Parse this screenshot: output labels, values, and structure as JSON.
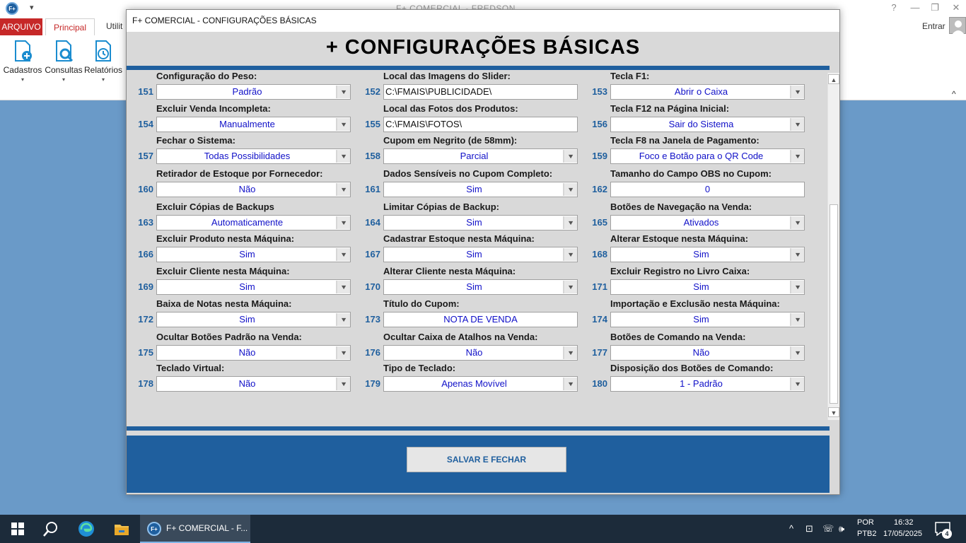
{
  "app": {
    "logo_text": "F+",
    "title": "F+ COMERCIAL - FREDSON",
    "qat_icon": "▾",
    "window_controls": [
      "?",
      "—",
      "❐",
      "✕"
    ],
    "tabs": {
      "arquivo": "ARQUIVO",
      "principal": "Principal",
      "utilitarios": "Utilit"
    },
    "entrar": "Entrar",
    "ribbon": [
      {
        "label": "Cadastros",
        "icon": "cadastros-icon"
      },
      {
        "label": "Consultas",
        "icon": "consultas-icon"
      },
      {
        "label": "Relatórios",
        "icon": "relatorios-icon"
      }
    ],
    "collapse_icon": "^"
  },
  "dialog": {
    "title": "F+ COMERCIAL - CONFIGURAÇÕES BÁSICAS",
    "heading": "+ CONFIGURAÇÕES BÁSICAS",
    "save_button": "SALVAR E FECHAR",
    "fields": [
      {
        "num": "151",
        "label": "Configuração do Peso:",
        "value": "Padrão",
        "kind": "select"
      },
      {
        "num": "152",
        "label": "Local das Imagens do Slider:",
        "value": "C:\\FMAIS\\PUBLICIDADE\\",
        "kind": "input-left"
      },
      {
        "num": "153",
        "label": "Tecla F1:",
        "value": "Abrir o Caixa",
        "kind": "select"
      },
      {
        "num": "154",
        "label": "Excluir Venda Incompleta:",
        "value": "Manualmente",
        "kind": "select"
      },
      {
        "num": "155",
        "label": "Local das Fotos dos Produtos:",
        "value": "C:\\FMAIS\\FOTOS\\",
        "kind": "input-left"
      },
      {
        "num": "156",
        "label": "Tecla F12 na Página Inicial:",
        "value": "Sair do Sistema",
        "kind": "select"
      },
      {
        "num": "157",
        "label": "Fechar o Sistema:",
        "value": "Todas Possibilidades",
        "kind": "select"
      },
      {
        "num": "158",
        "label": "Cupom em Negrito (de 58mm):",
        "value": "Parcial",
        "kind": "select"
      },
      {
        "num": "159",
        "label": "Tecla F8 na Janela de Pagamento:",
        "value": "Foco e Botão para o QR Code",
        "kind": "select"
      },
      {
        "num": "160",
        "label": "Retirador de Estoque por Fornecedor:",
        "value": "Não",
        "kind": "select"
      },
      {
        "num": "161",
        "label": "Dados Sensíveis no Cupom Completo:",
        "value": "Sim",
        "kind": "select"
      },
      {
        "num": "162",
        "label": "Tamanho do Campo OBS no Cupom:",
        "value": "0",
        "kind": "input-center"
      },
      {
        "num": "163",
        "label": "Excluir Cópias de Backups",
        "value": "Automaticamente",
        "kind": "select"
      },
      {
        "num": "164",
        "label": "Limitar Cópias de Backup:",
        "value": "Sim",
        "kind": "select"
      },
      {
        "num": "165",
        "label": "Botões de Navegação na Venda:",
        "value": "Ativados",
        "kind": "select"
      },
      {
        "num": "166",
        "label": "Excluir Produto nesta Máquina:",
        "value": "Sim",
        "kind": "select"
      },
      {
        "num": "167",
        "label": "Cadastrar Estoque nesta Máquina:",
        "value": "Sim",
        "kind": "select"
      },
      {
        "num": "168",
        "label": "Alterar Estoque nesta Máquina:",
        "value": "Sim",
        "kind": "select"
      },
      {
        "num": "169",
        "label": "Excluir Cliente nesta Máquina:",
        "value": "Sim",
        "kind": "select"
      },
      {
        "num": "170",
        "label": "Alterar Cliente nesta Máquina:",
        "value": "Sim",
        "kind": "select"
      },
      {
        "num": "171",
        "label": "Excluir Registro no Livro Caixa:",
        "value": "Sim",
        "kind": "select"
      },
      {
        "num": "172",
        "label": "Baixa de Notas nesta Máquina:",
        "value": "Sim",
        "kind": "select"
      },
      {
        "num": "173",
        "label": "Título do Cupom:",
        "value": "NOTA DE VENDA",
        "kind": "input-center"
      },
      {
        "num": "174",
        "label": "Importação e Exclusão nesta Máquina:",
        "value": "Sim",
        "kind": "select"
      },
      {
        "num": "175",
        "label": "Ocultar Botões Padrão na Venda:",
        "value": "Não",
        "kind": "select"
      },
      {
        "num": "176",
        "label": "Ocultar Caixa de Atalhos na Venda:",
        "value": "Não",
        "kind": "select"
      },
      {
        "num": "177",
        "label": "Botões de Comando na Venda:",
        "value": "Não",
        "kind": "select"
      },
      {
        "num": "178",
        "label": "Teclado Virtual:",
        "value": "Não",
        "kind": "select"
      },
      {
        "num": "179",
        "label": "Tipo de Teclado:",
        "value": "Apenas Movível",
        "kind": "select"
      },
      {
        "num": "180",
        "label": "Disposição dos Botões de Comando:",
        "value": "1 - Padrão",
        "kind": "select"
      }
    ]
  },
  "taskbar": {
    "app_logo": "F+",
    "app_label": "F+ COMERCIAL - F...",
    "lang_1": "POR",
    "lang_2": "PTB2",
    "time": "16:32",
    "date": "17/05/2025",
    "notification_count": "4",
    "tray_icons": [
      "^",
      "⊡",
      "☏",
      "🕪"
    ]
  },
  "colors": {
    "brand_blue": "#1f5f9e",
    "value_blue": "#1010c8",
    "arquivo_red": "#c62828"
  }
}
